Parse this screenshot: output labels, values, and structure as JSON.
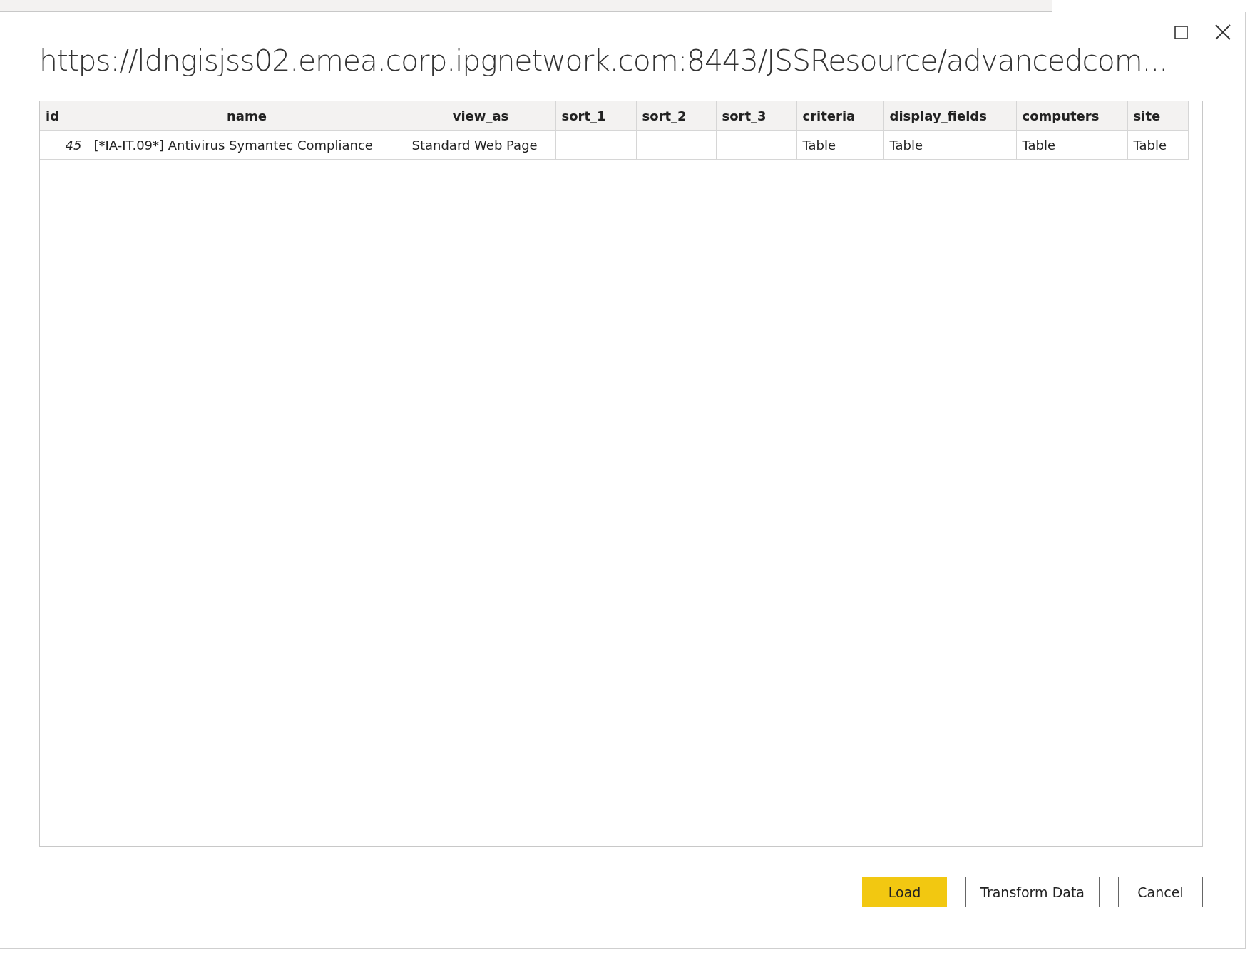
{
  "dialog": {
    "title": "https://ldngisjss02.emea.corp.ipgnetwork.com:8443/JSSResource/advancedcom..."
  },
  "table": {
    "columns": [
      "id",
      "name",
      "view_as",
      "sort_1",
      "sort_2",
      "sort_3",
      "criteria",
      "display_fields",
      "computers",
      "site"
    ],
    "rows": [
      [
        "45",
        "[*IA-IT.09*] Antivirus Symantec Compliance",
        "Standard Web Page",
        "",
        "",
        "",
        "Table",
        "Table",
        "Table",
        "Table"
      ]
    ]
  },
  "buttons": [
    {
      "label": "Load",
      "kind": "primary"
    },
    {
      "label": "Transform Data",
      "kind": "secondary"
    },
    {
      "label": "Cancel",
      "kind": "secondary"
    }
  ]
}
